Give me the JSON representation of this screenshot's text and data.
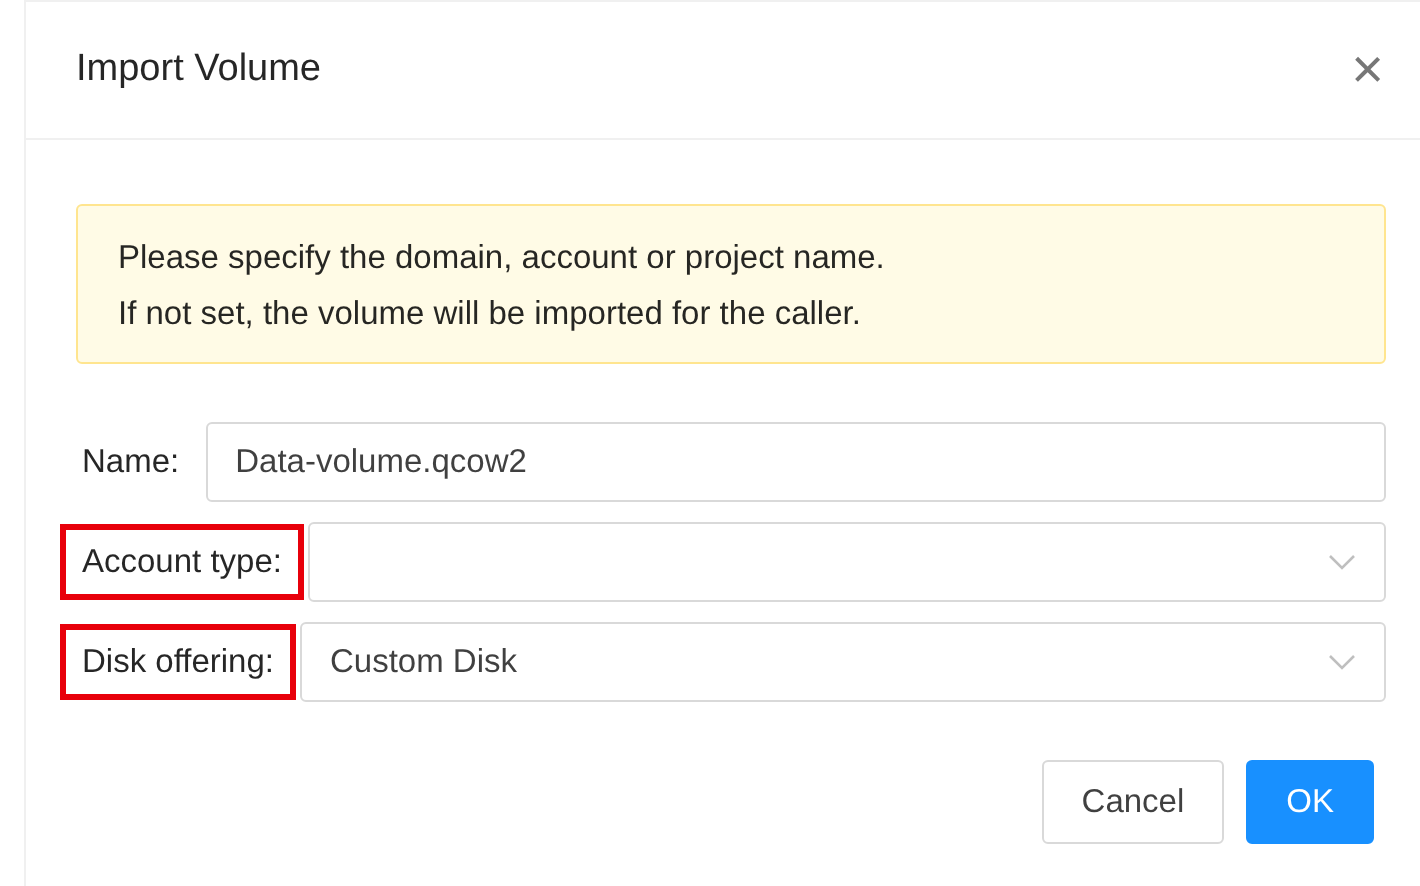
{
  "dialog": {
    "title": "Import Volume",
    "close": "×"
  },
  "alert": {
    "lines": [
      "Please specify the domain, account or project name.",
      "If not set, the volume will be imported for the caller."
    ]
  },
  "fields": [
    {
      "label": "Name:",
      "kind": "input",
      "value": "Data-volume.qcow2",
      "highlighted": false
    },
    {
      "label": "Account type:",
      "kind": "select",
      "highlighted": true
    },
    {
      "label": "Disk offering:",
      "kind": "select",
      "value": "Custom Disk",
      "highlighted": true
    }
  ],
  "buttons": [
    {
      "label": "Cancel",
      "primary": false
    },
    {
      "label": "OK",
      "primary": true
    }
  ]
}
